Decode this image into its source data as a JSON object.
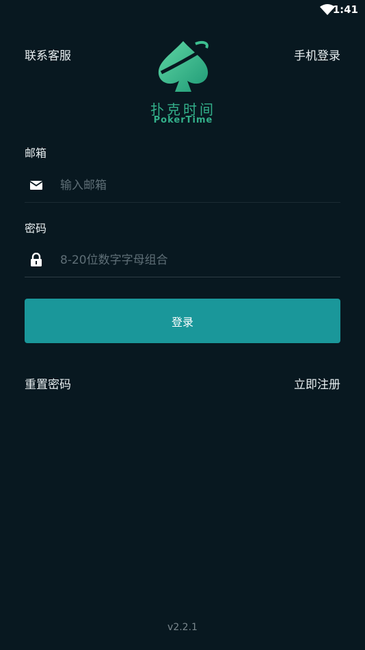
{
  "status_bar": {
    "time": "1:41",
    "wifi_icon": "wifi-icon"
  },
  "header": {
    "contact_label": "联系客服",
    "phone_login_label": "手机登录",
    "logo_cn": "扑克时间",
    "logo_en": "PokerTime"
  },
  "form": {
    "email_label": "邮箱",
    "email_placeholder": "输入邮箱",
    "email_value": "",
    "email_icon": "envelope-icon",
    "password_label": "密码",
    "password_placeholder": "8-20位数字字母组合",
    "password_value": "",
    "password_icon": "lock-icon",
    "login_label": "登录"
  },
  "footer": {
    "reset_label": "重置密码",
    "register_label": "立即注册",
    "version": "v2.2.1"
  },
  "colors": {
    "background": "#081820",
    "accent": "#1a979a",
    "logo_green": "#33b08a"
  }
}
